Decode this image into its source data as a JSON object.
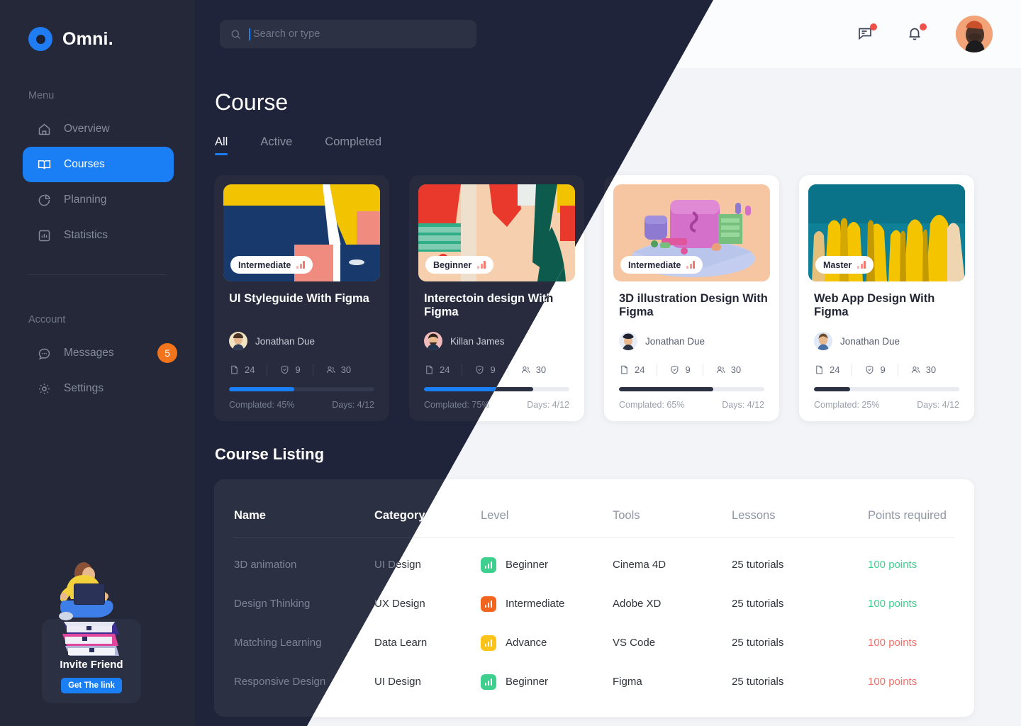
{
  "brand": {
    "name": "Omni.",
    "logo_icon": "omni-circle-logo"
  },
  "sidebar": {
    "menu_label": "Menu",
    "account_label": "Account",
    "menu_items": [
      {
        "label": "Overview",
        "icon": "home-icon",
        "active": false
      },
      {
        "label": "Courses",
        "icon": "book-icon",
        "active": true
      },
      {
        "label": "Planning",
        "icon": "pie-chart-icon",
        "active": false
      },
      {
        "label": "Statistics",
        "icon": "bar-chart-icon",
        "active": false
      }
    ],
    "account_items": [
      {
        "label": "Messages",
        "icon": "chat-icon",
        "badge": "5"
      },
      {
        "label": "Settings",
        "icon": "gear-icon",
        "badge": ""
      }
    ],
    "invite": {
      "title": "Invite Friend",
      "button": "Get The link",
      "art": "girl-on-books-illustration"
    }
  },
  "topbar": {
    "search": {
      "placeholder": "Search or type",
      "icon": "search-icon",
      "value": ""
    },
    "messages_icon": "message-square-icon",
    "notifications_icon": "bell-icon",
    "avatar": "user-avatar",
    "has_message_dot": true,
    "has_notification_dot": true
  },
  "main": {
    "page_title": "Course",
    "tabs": [
      {
        "label": "All",
        "active": true
      },
      {
        "label": "Active",
        "active": false
      },
      {
        "label": "Completed",
        "active": false
      }
    ],
    "cards": [
      {
        "level": "Intermediate",
        "title": "UI Styleguide With Figma",
        "author": "Jonathan Due",
        "files": "24",
        "badges": "9",
        "students": "30",
        "progress": 45,
        "completed": "Complated: 45%",
        "days": "Days: 4/12"
      },
      {
        "level": "Beginner",
        "title": "Interectoin design With Figma",
        "author": "Killan James",
        "files": "24",
        "badges": "9",
        "students": "30",
        "progress": 75,
        "completed": "Complated: 75%",
        "days": "Days: 4/12"
      },
      {
        "level": "Intermediate",
        "title": "3D illustration Design With Figma",
        "author": "Jonathan Due",
        "files": "24",
        "badges": "9",
        "students": "30",
        "progress": 65,
        "completed": "Complated: 65%",
        "days": "Days: 4/12"
      },
      {
        "level": "Master",
        "title": "Web App Design With Figma",
        "author": "Jonathan Due",
        "files": "24",
        "badges": "9",
        "students": "30",
        "progress": 25,
        "completed": "Complated: 25%",
        "days": "Days: 4/12"
      }
    ],
    "listing": {
      "title": "Course Listing",
      "columns": [
        "Name",
        "Category",
        "Level",
        "Tools",
        "Lessons",
        "Points required"
      ],
      "rows": [
        {
          "name": "3D animation",
          "category": "UI Design",
          "level": "Beginner",
          "level_color": "#3ecf8e",
          "tools": "Cinema 4D",
          "lessons": "25 tutorials",
          "points": "100 points",
          "points_state": "green"
        },
        {
          "name": "Design Thinking",
          "category": "UX Design",
          "level": "Intermediate",
          "level_color": "#f2651f",
          "tools": "Adobe XD",
          "lessons": "25 tutorials",
          "points": "100 points",
          "points_state": "green"
        },
        {
          "name": "Matching Learning",
          "category": "Data Learn",
          "level": "Advance",
          "level_color": "#fcc419",
          "tools": "VS Code",
          "lessons": "25 tutorials",
          "points": "100 points",
          "points_state": "red"
        },
        {
          "name": "Responsive Design",
          "category": "UI Design",
          "level": "Beginner",
          "level_color": "#3ecf8e",
          "tools": "Figma",
          "lessons": "25 tutorials",
          "points": "100 points",
          "points_state": "red"
        }
      ]
    }
  },
  "colors": {
    "accent": "#1a7ef5",
    "sidebar_bg": "#242838",
    "dark_bg": "#20243a",
    "light_bg": "#f3f4f7",
    "badge_orange": "#f2741c",
    "points_green": "#3ecf8e",
    "points_red": "#f07067"
  }
}
